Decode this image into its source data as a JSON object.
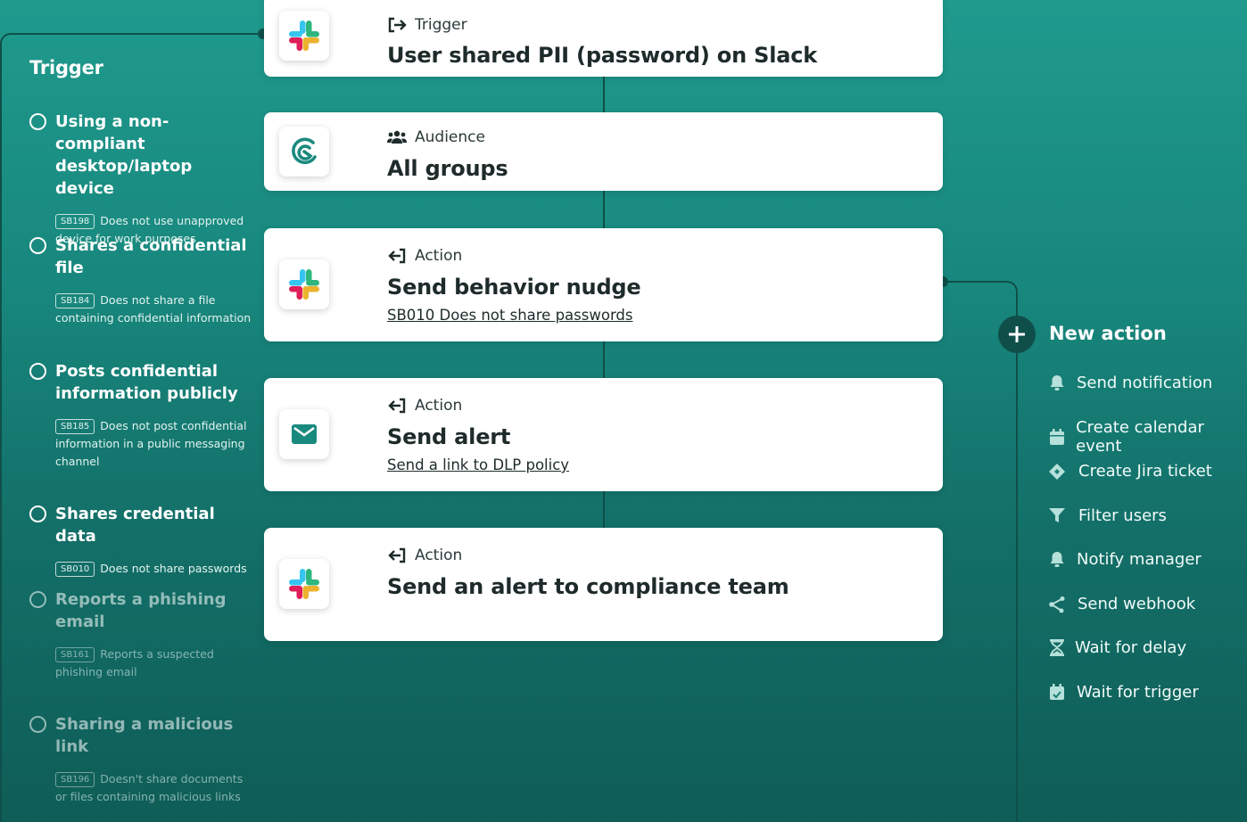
{
  "left_panel": {
    "title": "Trigger",
    "items": [
      {
        "label": "Using a non-compliant desktop/laptop device",
        "code": "SB198",
        "desc": "Does not use unapproved device for work purposes"
      },
      {
        "label": "Shares a confidential file",
        "code": "SB184",
        "desc": "Does not share a file containing confidential information"
      },
      {
        "label": "Posts confidential information publicly",
        "code": "SB185",
        "desc": "Does not post confidential information in a public messaging channel"
      },
      {
        "label": "Shares credential data",
        "code": "SB010",
        "desc": "Does not share passwords"
      },
      {
        "label": "Reports a phishing email",
        "code": "SB161",
        "desc": "Reports a suspected phishing email"
      },
      {
        "label": "Sharing a malicious link",
        "code": "SB196",
        "desc": "Doesn't share documents or files containing malicious links"
      }
    ]
  },
  "cards": [
    {
      "kind": "Trigger",
      "title": "User shared PII (password) on Slack",
      "icon": "slack-icon"
    },
    {
      "kind": "Audience",
      "title": "All groups",
      "icon": "brand-logo-icon"
    },
    {
      "kind": "Action",
      "title": "Send behavior nudge",
      "link": "SB010 Does not share passwords",
      "icon": "slack-icon"
    },
    {
      "kind": "Action",
      "title": "Send alert",
      "link": "Send a link to DLP policy",
      "icon": "mail-icon"
    },
    {
      "kind": "Action",
      "title": "Send an alert to compliance team",
      "icon": "slack-icon"
    }
  ],
  "right_panel": {
    "new_action_label": "New action",
    "actions": [
      {
        "label": "Send notification",
        "icon": "bell-icon"
      },
      {
        "label": "Create calendar event",
        "icon": "calendar-icon"
      },
      {
        "label": "Create Jira ticket",
        "icon": "jira-icon"
      },
      {
        "label": "Filter users",
        "icon": "filter-icon"
      },
      {
        "label": "Notify manager",
        "icon": "bell-icon"
      },
      {
        "label": "Send webhook",
        "icon": "webhook-icon"
      },
      {
        "label": "Wait for delay",
        "icon": "hourglass-icon"
      },
      {
        "label": "Wait for trigger",
        "icon": "calendar-check-icon"
      }
    ]
  },
  "colors": {
    "accent": "#0f4f4a",
    "mail_icon": "#1a8a7f",
    "background_top": "#1f9a8d",
    "background_bottom": "#0f5d57"
  }
}
